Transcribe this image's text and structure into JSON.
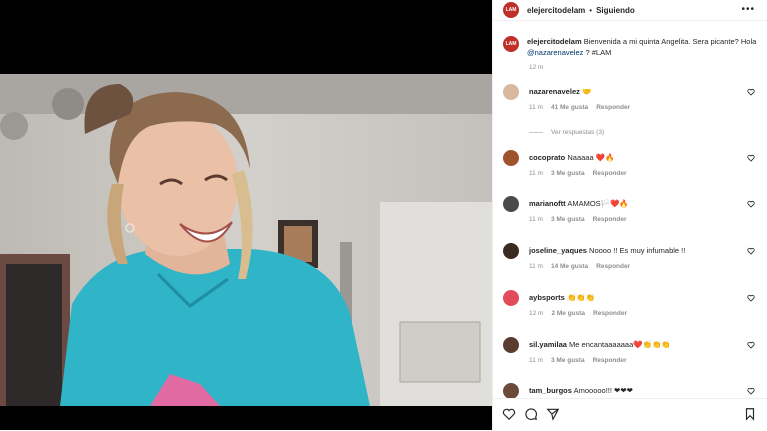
{
  "post": {
    "username": "elejercitodelam",
    "separator": "•",
    "follow_status": "Siguiendo",
    "more": "•••",
    "avatar_text": "LAM",
    "caption_prefix": "Bienvenida a mi quinta Angelita. Sera picante? Hola",
    "caption_mention": "@nazarenavelez",
    "caption_suffix": "? #LAM",
    "time": "12 m"
  },
  "replies_label": "Ver respuestas (3)",
  "comments": [
    {
      "user": "nazarenavelez",
      "text": "🤝",
      "time": "11 m",
      "likes": "41 Me gusta",
      "reply": "Responder",
      "avatar_color": "#d9b8a0"
    },
    {
      "user": "cocoprato",
      "text": "Naaaaa ❤️🔥",
      "time": "11 m",
      "likes": "3 Me gusta",
      "reply": "Responder",
      "avatar_color": "#a0522d"
    },
    {
      "user": "marianoftt",
      "text": "AMAMOS🏳️❤️🔥",
      "time": "11 m",
      "likes": "3 Me gusta",
      "reply": "Responder",
      "avatar_color": "#4a4a4a"
    },
    {
      "user": "joseline_yaques",
      "text": "Noooo !! Es muy infumable !!",
      "time": "11 m",
      "likes": "14 Me gusta",
      "reply": "Responder",
      "avatar_color": "#3a2a22"
    },
    {
      "user": "aybsports",
      "text": "👏👏👏",
      "time": "12 m",
      "likes": "2 Me gusta",
      "reply": "Responder",
      "avatar_color": "#e14b5a"
    },
    {
      "user": "sil.yamilaa",
      "text": "Me encantaaaaaaa❤️👏👏👏",
      "time": "11 m",
      "likes": "3 Me gusta",
      "reply": "Responder",
      "avatar_color": "#5a3d30"
    },
    {
      "user": "tam_burgos",
      "text": "Amooooo!!! ❤❤❤",
      "time": "",
      "likes": "",
      "reply": "",
      "avatar_color": "#6b4a3a"
    }
  ],
  "colors": {
    "heart_outline": "#262626",
    "link": "#00376b",
    "shirt": "#2fb4c8"
  },
  "icons": [
    "heart-icon",
    "comment-icon",
    "share-icon",
    "bookmark-icon",
    "more-icon"
  ]
}
